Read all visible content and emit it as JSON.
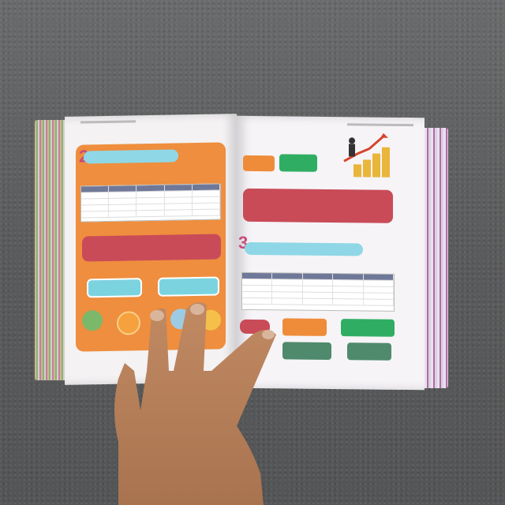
{
  "scene": {
    "description_colors": {
      "carpet": "#5d5e5f",
      "orange_panel": "#ee8e3e",
      "teal_bar": "#8fd7e6",
      "red_banner": "#c94b58",
      "green_box": "#2fae63",
      "skin": "#b9825c"
    }
  },
  "left_page": {
    "section_number": "2"
  },
  "right_page": {
    "section_number": "3"
  }
}
